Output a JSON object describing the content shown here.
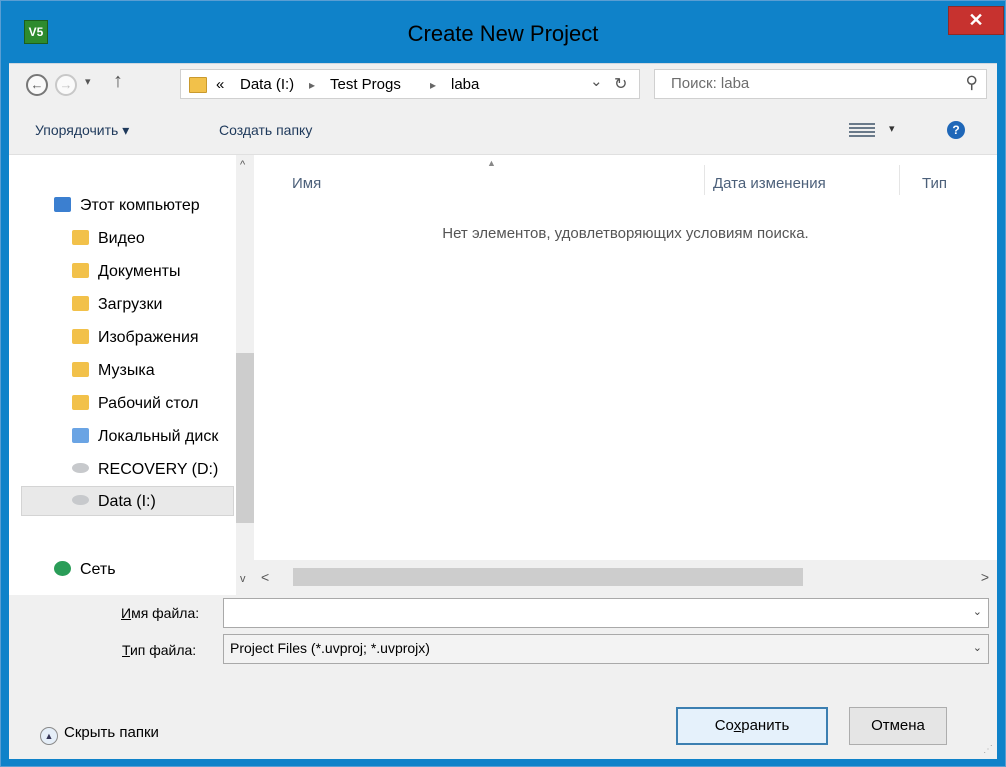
{
  "window": {
    "title": "Create New Project",
    "app_icon_text": "V5",
    "close_glyph": "✕"
  },
  "navbar": {
    "back_glyph": "←",
    "forward_glyph": "→",
    "recent_glyph": "▾",
    "up_glyph": "↑",
    "breadcrumb_prefix": "«",
    "breadcrumb": [
      "Data (I:)",
      "Test Progs",
      "laba"
    ],
    "breadcrumb_sep": "▸",
    "dropdown_glyph": "⌄",
    "refresh_glyph": "↻",
    "search_placeholder": "Поиск: laba",
    "search_glyph": "⚲"
  },
  "toolbar": {
    "organize_label": "Упорядочить ▾",
    "new_folder_label": "Создать папку",
    "view_caret": "▾",
    "help_glyph": "?"
  },
  "nav_pane": {
    "computer_label": "Этот компьютер",
    "items": [
      {
        "label": "Видео",
        "icon": "video-folder-icon"
      },
      {
        "label": "Документы",
        "icon": "documents-folder-icon"
      },
      {
        "label": "Загрузки",
        "icon": "downloads-folder-icon"
      },
      {
        "label": "Изображения",
        "icon": "pictures-folder-icon"
      },
      {
        "label": "Музыка",
        "icon": "music-folder-icon"
      },
      {
        "label": "Рабочий стол",
        "icon": "desktop-folder-icon"
      },
      {
        "label": "Локальный диск",
        "icon": "local-disk-icon"
      },
      {
        "label": "RECOVERY (D:)",
        "icon": "drive-icon"
      },
      {
        "label": "Data (I:)",
        "icon": "drive-icon",
        "selected": true
      }
    ],
    "network_label": "Сеть"
  },
  "file_list": {
    "columns": [
      "Имя",
      "Дата изменения",
      "Тип"
    ],
    "empty_message": "Нет элементов, удовлетворяющих условиям поиска."
  },
  "scroll": {
    "up_glyph": "^",
    "down_glyph": "v",
    "left_glyph": "<",
    "right_glyph": ">"
  },
  "form": {
    "filename_label_accel": "И",
    "filename_label_rest": "мя файла:",
    "filename_value": "",
    "filetype_label_accel": "Т",
    "filetype_label_rest": "ип файла:",
    "filetype_value": "Project Files (*.uvproj; *.uvprojx)",
    "combo_arrow": "⌄"
  },
  "footer": {
    "hide_folders_label": "Скрыть папки",
    "hide_glyph": "▲",
    "save_label_pre": "Со",
    "save_label_accel": "х",
    "save_label_post": "ранить",
    "cancel_label": "Отмена"
  }
}
